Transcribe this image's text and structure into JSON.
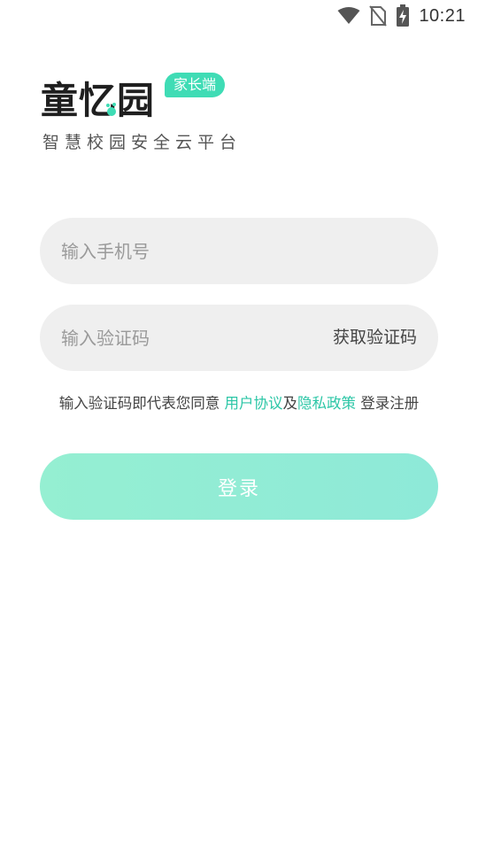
{
  "status_bar": {
    "time": "10:21",
    "icons": [
      "wifi-icon",
      "no-sim-icon",
      "battery-charging-icon"
    ]
  },
  "brand": {
    "logo_text": "童忆园",
    "badge": "家长端",
    "slogan": "智慧校园安全云平台",
    "accent_color": "#3fdcb5"
  },
  "form": {
    "phone_placeholder": "输入手机号",
    "code_placeholder": "输入验证码",
    "get_code_label": "获取验证码"
  },
  "agreement": {
    "prefix": "输入验证码即代表您同意 ",
    "user_agreement": "用户协议",
    "and": "及",
    "privacy_policy": "隐私政策",
    "suffix": " 登录注册",
    "link_color": "#2bc6a6"
  },
  "login_button": {
    "label": "登录",
    "color": "#92edd4"
  }
}
